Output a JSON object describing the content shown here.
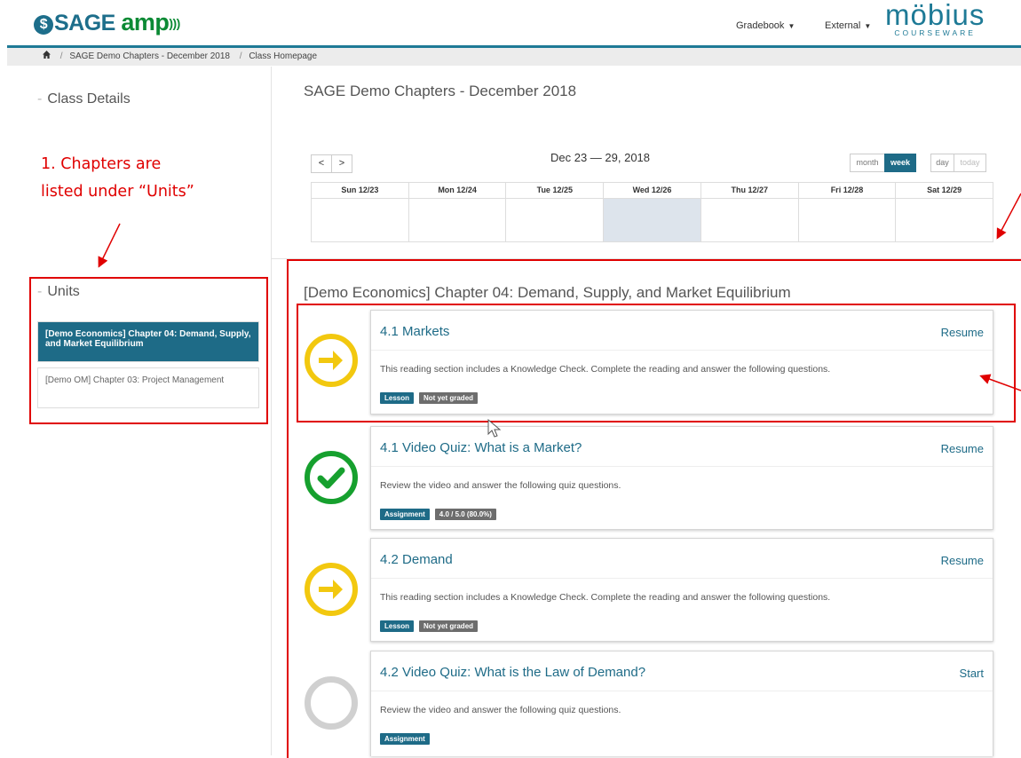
{
  "header": {
    "logo_sage": "SAGE",
    "logo_amp": "amp",
    "menu_gradebook": "Gradebook",
    "menu_external": "External",
    "mobius_title": "möbius",
    "mobius_subtitle": "COURSEWARE"
  },
  "breadcrumb": {
    "home_icon": "home-icon",
    "items": [
      "SAGE Demo Chapters - December 2018",
      "Class Homepage"
    ]
  },
  "sidebar": {
    "class_details": "Class Details",
    "units_title": "Units",
    "units": [
      {
        "label": "[Demo Economics] Chapter 04: Demand, Supply, and Market Equilibrium",
        "active": true
      },
      {
        "label": "[Demo OM] Chapter 03: Project Management",
        "active": false
      }
    ]
  },
  "main": {
    "class_title": "SAGE Demo Chapters - December 2018",
    "calendar": {
      "prev": "<",
      "next": ">",
      "range": "Dec 23 — 29, 2018",
      "views": [
        "month",
        "week",
        "day",
        "today"
      ],
      "active_view": "week",
      "days": [
        "Sun 12/23",
        "Mon 12/24",
        "Tue 12/25",
        "Wed 12/26",
        "Thu 12/27",
        "Fri 12/28",
        "Sat 12/29"
      ],
      "highlight_day": "Wed 12/26"
    },
    "chapter_title": "[Demo Economics] Chapter 04: Demand, Supply, and Market Equilibrium",
    "activities": [
      {
        "title": "4.1 Markets",
        "action": "Resume",
        "description": "This reading section includes a Knowledge Check. Complete the reading and answer the following questions.",
        "tags": [
          "Lesson",
          "Not yet graded"
        ],
        "status": "in-progress"
      },
      {
        "title": "4.1 Video Quiz: What is a Market?",
        "action": "Resume",
        "description": "Review the video and answer the following quiz questions.",
        "tags": [
          "Assignment",
          "4.0 / 5.0 (80.0%)"
        ],
        "status": "complete"
      },
      {
        "title": "4.2 Demand",
        "action": "Resume",
        "description": "This reading section includes a Knowledge Check. Complete the reading and answer the following questions.",
        "tags": [
          "Lesson",
          "Not yet graded"
        ],
        "status": "in-progress"
      },
      {
        "title": "4.2 Video Quiz: What is the Law of Demand?",
        "action": "Start",
        "description": "Review the video and answer the following quiz questions.",
        "tags": [
          "Assignment"
        ],
        "status": "not-started"
      }
    ]
  },
  "annotation": {
    "line1": "1. Chapters are",
    "line2": "listed under “Units”",
    "color": "#e00000"
  },
  "colors": {
    "brand": "#1e6b87",
    "in_progress": "#f2c80f",
    "complete": "#16a02e",
    "not_started": "#d0d0d0"
  }
}
